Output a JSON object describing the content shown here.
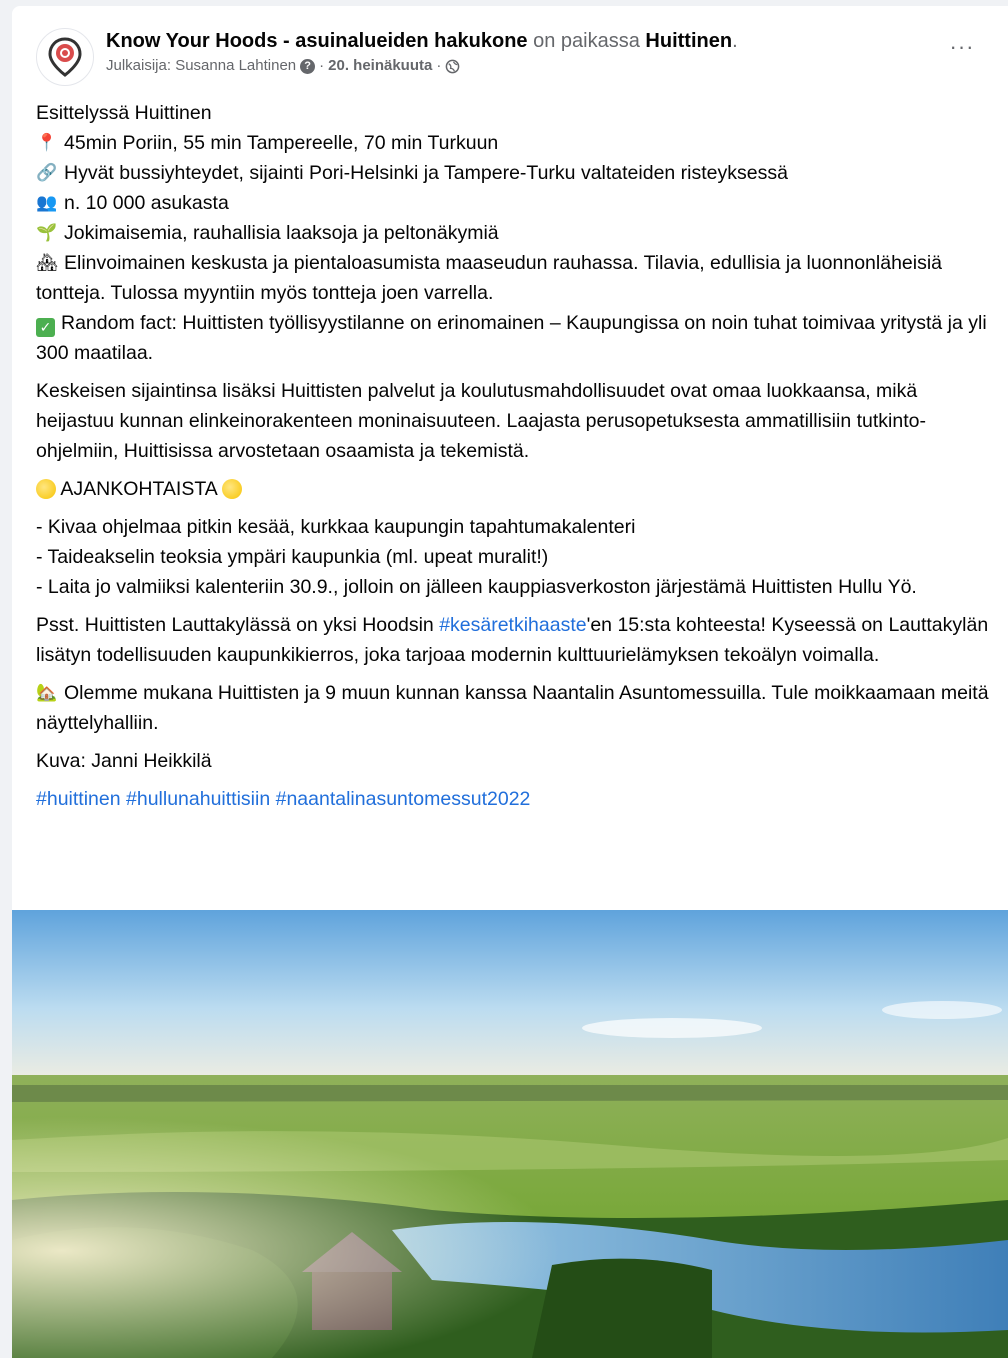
{
  "post": {
    "page_name": "Know Your Hoods - asuinalueiden hakukone",
    "location_prefix": "on paikassa",
    "location": "Huittinen",
    "location_suffix": ".",
    "publisher": "Julkaisija: Susanna Lahtinen",
    "date": "20. heinäkuuta",
    "separator": "·",
    "more": "···"
  },
  "content": {
    "intro": "Esittelyssä Huittinen",
    "bullets": [
      {
        "icon": "pin-icon",
        "glyph": "📍",
        "text": "45min Poriin, 55 min Tampereelle, 70 min Turkuun"
      },
      {
        "icon": "link-icon",
        "glyph": "🔗",
        "text": "Hyvät bussiyhteydet, sijainti Pori-Helsinki ja Tampere-Turku valtateiden risteyksessä"
      },
      {
        "icon": "people-icon",
        "glyph": "👥",
        "text": "n. 10 000 asukasta"
      },
      {
        "icon": "seedling-icon",
        "glyph": "🌱",
        "text": "Jokimaisemia, rauhallisia laaksoja ja peltonäkymiä"
      },
      {
        "icon": "houses-icon",
        "glyph": "🏘",
        "text": "Elinvoimainen keskusta ja pientaloasumista maaseudun rauhassa. Tilavia, edullisia ja luonnonläheisiä tontteja. Tulossa myyntiin myös tontteja joen varrella."
      },
      {
        "icon": "check-icon",
        "glyph": "✓",
        "text": "Random fact: Huittisten työllisyystilanne on erinomainen – Kaupungissa on noin tuhat toimivaa yritystä ja yli 300 maatilaa."
      }
    ],
    "paragraph1": "Keskeisen sijaintinsa lisäksi Huittisten palvelut ja koulutusmahdollisuudet ovat omaa luokkaansa, mikä heijastuu kunnan elinkeinorakenteen moninaisuuteen. Laajasta perusopetuksesta ammatillisiin tutkinto-ohjelmiin, Huittisissa arvostetaan osaamista ja tekemistä.",
    "news_heading": "AJANKOHTAISTA",
    "news_items": [
      "- Kivaa ohjelmaa pitkin kesää, kurkkaa kaupungin tapahtumakalenteri",
      "- Taideakselin teoksia ympäri kaupunkia (ml. upeat muralit!)",
      "- Laita jo valmiiksi kalenteriin 30.9., jolloin on jälleen kauppiasverkoston järjestämä Huittisten Hullu Yö."
    ],
    "psst_before": "Psst. Huittisten Lauttakylässä on yksi Hoodsin ",
    "psst_hashtag": "#kesäretkihaaste",
    "psst_after": "'en 15:sta kohteesta! Kyseessä on Lauttakylän lisätyn todellisuuden kaupunkikierros, joka tarjoaa modernin kulttuurielämyksen tekoälyn voimalla.",
    "fair": "Olemme mukana Huittisten ja 9 muun kunnan kanssa Naantalin Asuntomessuilla. Tule moikkaamaan meitä näyttelyhalliin.",
    "photo_credit": "Kuva: Janni Heikkilä",
    "hashtags": [
      "#huittinen",
      "#hullunahuittisiin",
      "#naantalinasuntomessut2022"
    ]
  },
  "colors": {
    "link": "#216fdb",
    "muted": "#65676b",
    "background": "#f0f2f5",
    "logo": "#c0392b"
  }
}
